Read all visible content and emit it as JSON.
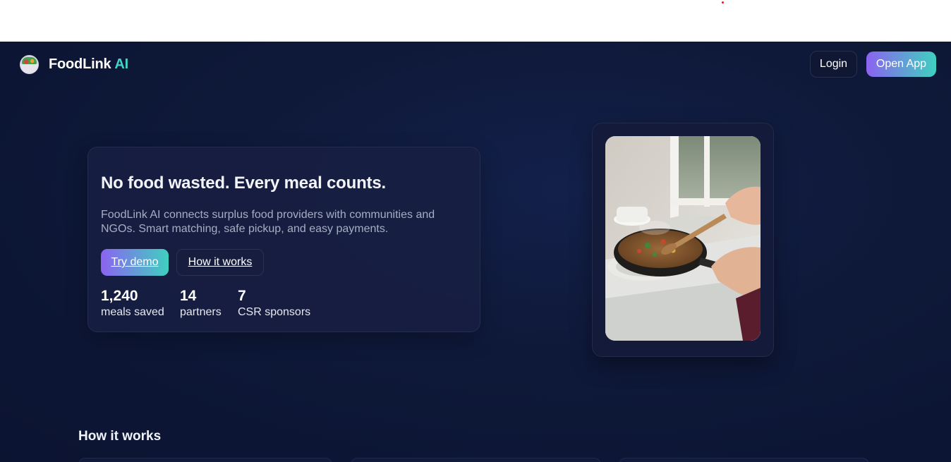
{
  "brand": {
    "name": "FoodLink",
    "suffix": "AI",
    "logo_icon": "salad-bowl-icon"
  },
  "nav": {
    "login_label": "Login",
    "open_app_label": "Open App"
  },
  "hero": {
    "title": "No food wasted. Every meal counts.",
    "description": "FoodLink AI connects surplus food providers with communities and NGOs. Smart matching, safe pickup, and easy payments.",
    "try_demo_label": "Try demo",
    "how_it_works_label": "How it works",
    "stats": [
      {
        "value": "1,240",
        "label": "meals saved"
      },
      {
        "value": "14",
        "label": "partners"
      },
      {
        "value": "7",
        "label": "CSR sponsors"
      }
    ]
  },
  "image": {
    "subject": "hands stirring vegetables in a frying pan by a window"
  },
  "sections": {
    "how_it_works_title": "How it works"
  },
  "colors": {
    "accent_purple": "#8b63f0",
    "accent_teal": "#3fd0c0",
    "background": "#0e1838"
  }
}
